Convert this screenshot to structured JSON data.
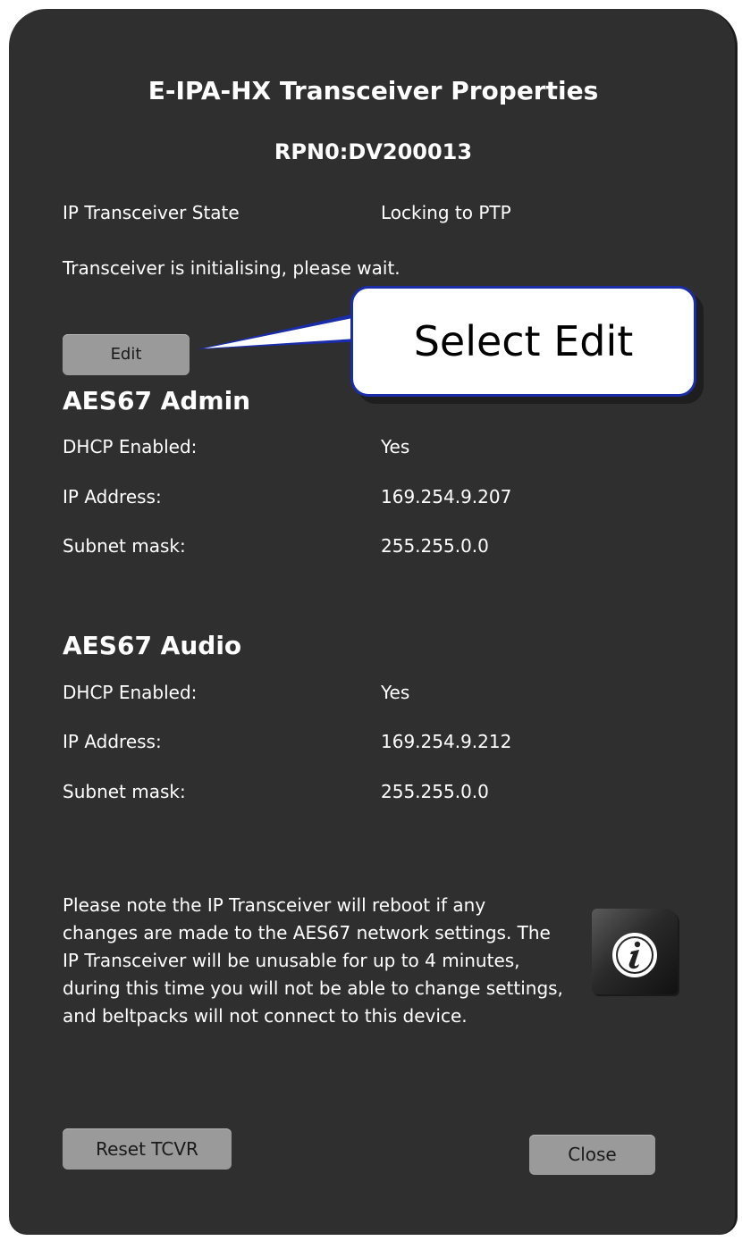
{
  "dialog": {
    "title": "E-IPA-HX Transceiver Properties",
    "serial": "RPN0:DV200013",
    "state_label": "IP Transceiver State",
    "state_value": "Locking to PTP",
    "status_message": "Transceiver is initialising, please wait."
  },
  "edit_button": {
    "label": "Edit"
  },
  "callout": {
    "text": "Select Edit"
  },
  "admin": {
    "heading": "AES67 Admin",
    "dhcp_label": "DHCP Enabled:",
    "dhcp_value": "Yes",
    "ip_label": "IP Address:",
    "ip_value": "169.254.9.207",
    "subnet_label": "Subnet mask:",
    "subnet_value": "255.255.0.0"
  },
  "audio": {
    "heading": "AES67 Audio",
    "dhcp_label": "DHCP Enabled:",
    "dhcp_value": "Yes",
    "ip_label": "IP Address:",
    "ip_value": "169.254.9.212",
    "subnet_label": "Subnet mask:",
    "subnet_value": "255.255.0.0"
  },
  "note": {
    "text": "Please note the IP Transceiver will reboot if any changes are made to the AES67 network settings. The IP Transceiver will be unusable for up to 4 minutes, during this time you will not be able to change settings, and beltpacks will not connect to this device."
  },
  "info_icon": {
    "glyph": "i",
    "name": "info-icon"
  },
  "buttons": {
    "reset_label": "Reset TCVR",
    "close_label": "Close"
  },
  "colors": {
    "panel_bg": "#2f2f2f",
    "button_bg": "#9a9a9a",
    "callout_border": "#1b2ca8"
  }
}
